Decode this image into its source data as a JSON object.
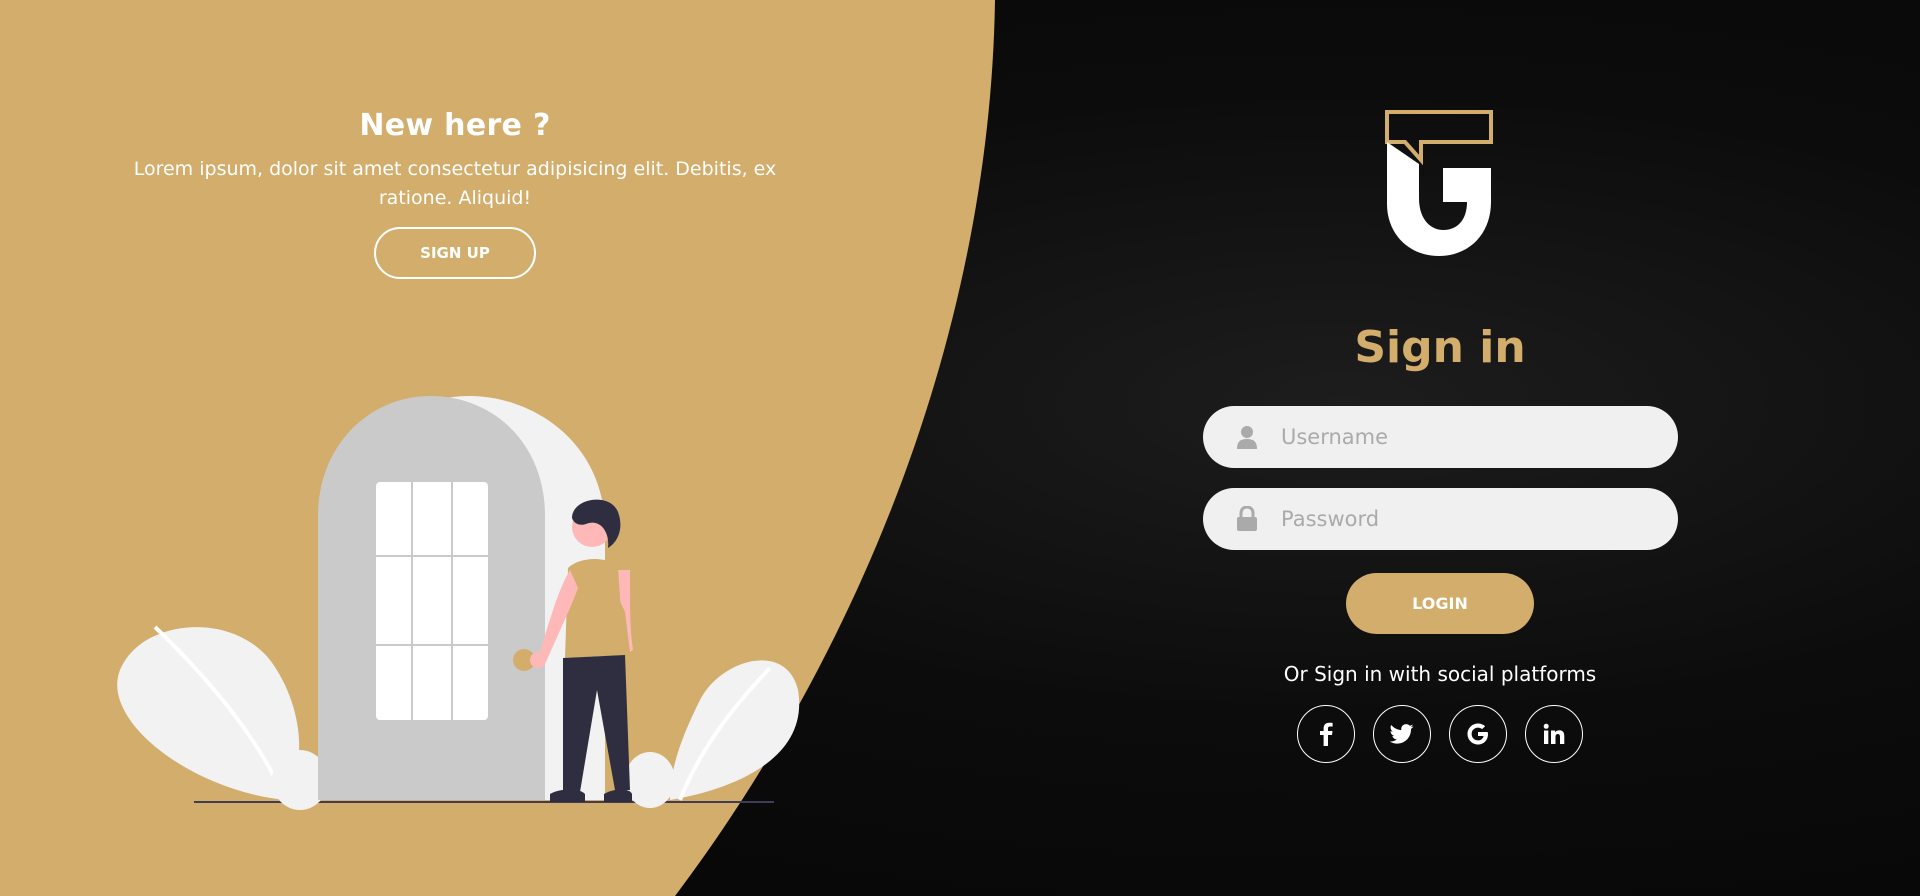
{
  "left": {
    "title": "New here ?",
    "description": "Lorem ipsum, dolor sit amet consectetur adipisicing elit. Debitis, ex ratione. Aliquid!",
    "signup_label": "SIGN UP"
  },
  "right": {
    "title": "Sign in",
    "username_placeholder": "Username",
    "password_placeholder": "Password",
    "login_label": "LOGIN",
    "social_text": "Or Sign in with social platforms",
    "socials": [
      {
        "name": "facebook",
        "icon": "facebook-icon",
        "glyph": "f"
      },
      {
        "name": "twitter",
        "icon": "twitter-icon",
        "glyph": ""
      },
      {
        "name": "google",
        "icon": "google-icon",
        "glyph": "G"
      },
      {
        "name": "linkedin",
        "icon": "linkedin-icon",
        "glyph": "in"
      }
    ]
  },
  "colors": {
    "accent": "#d2ad6c",
    "dark_bg": "#0b0b0b",
    "field_bg": "#f0f0f0"
  }
}
